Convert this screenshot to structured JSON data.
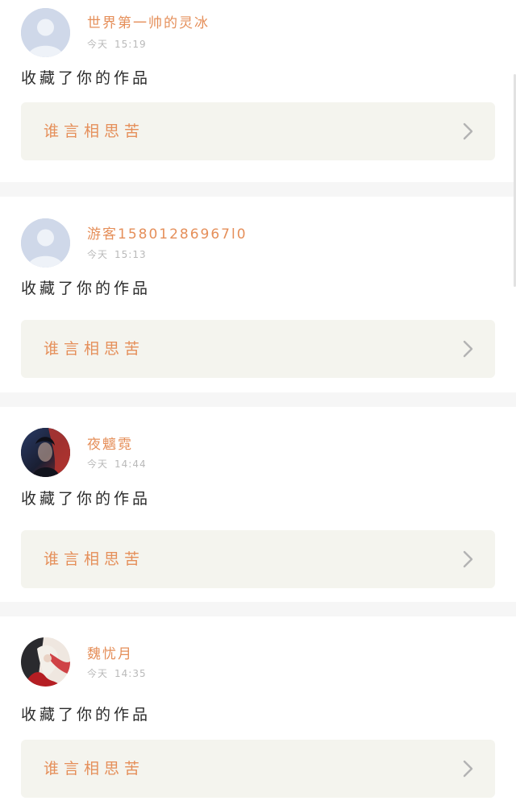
{
  "notifications": [
    {
      "username": "世界第一帅的灵冰",
      "time_label": "今天",
      "time": "15:19",
      "action": "收藏了你的作品",
      "work_title": "谁言相思苦",
      "avatar": "default-avatar"
    },
    {
      "username": "游客15801286967l0",
      "time_label": "今天",
      "time": "15:13",
      "action": "收藏了你的作品",
      "work_title": "谁言相思苦",
      "avatar": "default-avatar"
    },
    {
      "username": "夜魑霓",
      "time_label": "今天",
      "time": "14:44",
      "action": "收藏了你的作品",
      "work_title": "谁言相思苦",
      "avatar": "photo-avatar-dark"
    },
    {
      "username": "魏忧月",
      "time_label": "今天",
      "time": "14:35",
      "action": "收藏了你的作品",
      "work_title": "谁言相思苦",
      "avatar": "photo-avatar-illustration"
    }
  ],
  "colors": {
    "accent": "#e58f5a",
    "card_bg": "#ffffff",
    "separator": "#f6f6f6",
    "link_bg": "#f4f4ee",
    "time_text": "#b9b9b9",
    "action_text": "#2b2b2b"
  },
  "icons": {
    "chevron": "chevron-right-icon",
    "default_avatar": "person-silhouette-icon"
  }
}
